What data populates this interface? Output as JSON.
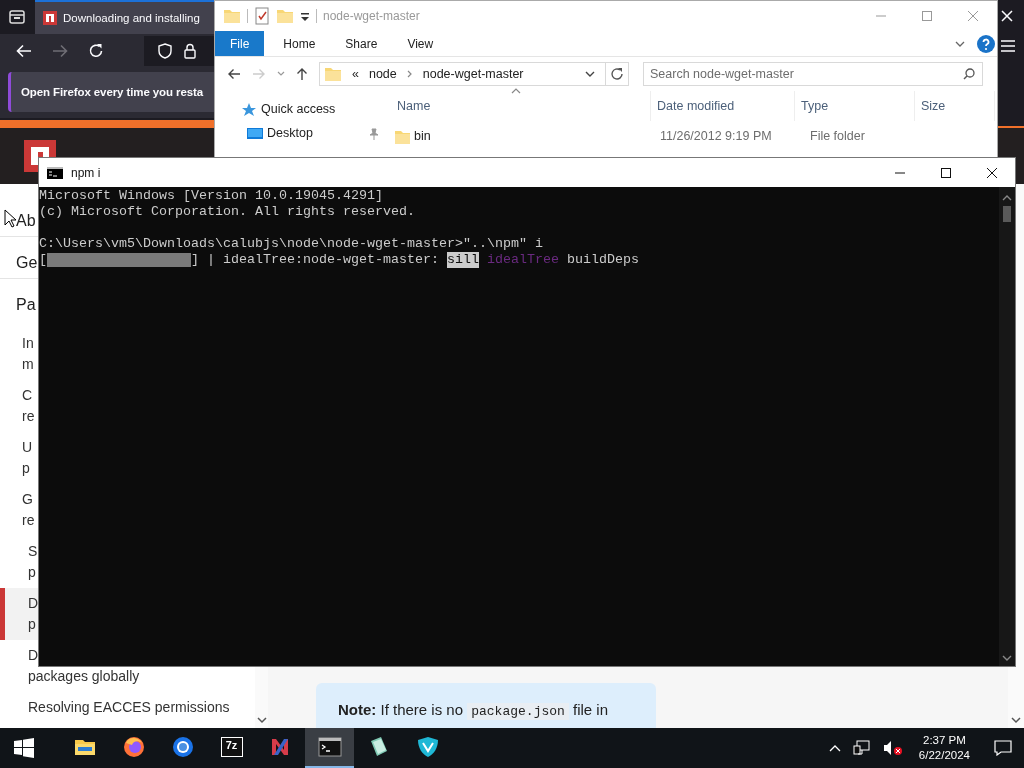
{
  "browser": {
    "tab_title": "Downloading and installing",
    "notification": "Open Firefox every time you resta",
    "sidebar": {
      "items": [
        {
          "lines": [
            "Ab"
          ],
          "selected": false
        },
        {
          "lines": [
            "Ge"
          ],
          "selected": false
        },
        {
          "lines": [
            "Pa"
          ],
          "selected": false,
          "children": [
            {
              "lines": [
                "In",
                "m"
              ],
              "selected": false
            },
            {
              "lines": [
                "C",
                "re"
              ],
              "selected": false
            },
            {
              "lines": [
                "U",
                "p"
              ],
              "selected": false
            },
            {
              "lines": [
                "G",
                "re"
              ],
              "selected": false,
              "children": [
                {
                  "lines": [
                    "S",
                    "p"
                  ],
                  "selected": false
                },
                {
                  "lines": [
                    "D",
                    "p"
                  ],
                  "selected": true
                },
                {
                  "lines": [
                    "D",
                    "packages globally"
                  ],
                  "selected": false
                },
                {
                  "lines": [
                    "Resolving EACCES permissions"
                  ],
                  "selected": false
                }
              ]
            }
          ]
        }
      ]
    },
    "note": {
      "label": "Note:",
      "text": "If there is no",
      "code": "package.json",
      "after": "file in"
    }
  },
  "explorer": {
    "title": "node-wget-master",
    "active": false,
    "ribbon_tabs": [
      {
        "label": "File",
        "selected": true
      },
      {
        "label": "Home",
        "selected": false
      },
      {
        "label": "Share",
        "selected": false
      },
      {
        "label": "View",
        "selected": false
      }
    ],
    "address": {
      "overflow": "«",
      "path": [
        "node",
        "node-wget-master"
      ]
    },
    "search": {
      "placeholder": "Search node-wget-master"
    },
    "nav": [
      {
        "label": "Quick access",
        "kind": "star",
        "pinned": false
      },
      {
        "label": "Desktop",
        "kind": "desktop",
        "pinned": true
      }
    ],
    "columns": [
      "Name",
      "Date modified",
      "Type",
      "Size"
    ],
    "rows": [
      {
        "name": "bin",
        "date": "11/26/2012 9:19 PM",
        "type": "File folder"
      }
    ]
  },
  "terminal": {
    "title": "npm i",
    "active": true,
    "blocks": [
      [
        [
          {
            "kind": "text",
            "text": "Microsoft Windows [Version 10.0.19045.4291]"
          }
        ],
        [
          {
            "kind": "text",
            "text": "(c) Microsoft Corporation. All rights reserved."
          }
        ]
      ],
      [
        [
          {
            "kind": "text",
            "text": "C:\\Users\\vm5\\Downloads\\calubjs\\node\\node-wget-master>\"..\\npm\" i"
          }
        ],
        [
          {
            "kind": "text",
            "text": "["
          },
          {
            "kind": "gauge",
            "level": 1
          },
          {
            "kind": "text",
            "text": "] | idealTree:node-wget-master:"
          },
          {
            "kind": "inverse",
            "text": "sill"
          },
          {
            "kind": "dim",
            "text": "idealTree"
          },
          {
            "kind": "text",
            "text": "buildDeps"
          }
        ]
      ]
    ]
  },
  "taskbar": {
    "items": [
      {
        "kind": "explorer",
        "selected": false
      },
      {
        "kind": "firefox",
        "selected": false
      },
      {
        "kind": "chrome",
        "selected": false
      },
      {
        "kind": "sevenzip",
        "label": "7z",
        "selected": false
      },
      {
        "kind": "appn",
        "selected": false
      },
      {
        "kind": "terminal",
        "selected": true
      },
      {
        "kind": "notepad",
        "selected": false
      },
      {
        "kind": "vpn",
        "selected": false
      }
    ],
    "time": "2:37 PM",
    "date": "6/22/2024"
  }
}
